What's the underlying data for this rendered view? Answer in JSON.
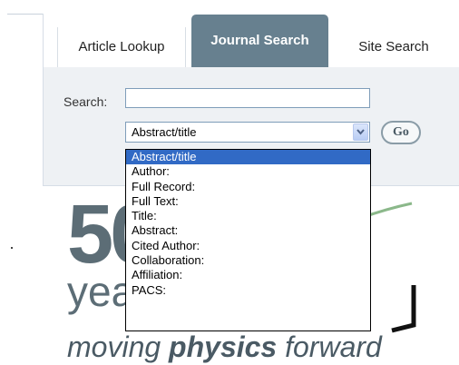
{
  "tabs": [
    {
      "label": "Article Lookup",
      "active": false
    },
    {
      "label": "Journal Search",
      "active": true
    },
    {
      "label": "Site Search",
      "active": false
    }
  ],
  "search": {
    "label": "Search:",
    "value": "",
    "placeholder": ""
  },
  "field_select": {
    "selected": "Abstract/title",
    "options": [
      "Abstract/title",
      "Author:",
      "Full Record:",
      "Full Text:",
      "Title:",
      "Abstract:",
      "Cited Author:",
      "Collaboration:",
      "Affiliation:",
      "PACS:"
    ]
  },
  "go_button": {
    "label": "Go"
  },
  "logo": {
    "number": "50",
    "years": "years",
    "tagline_prefix": "moving ",
    "tagline_bold": "physics",
    "tagline_suffix": " forward"
  },
  "colors": {
    "active_tab": "#67808f",
    "panel_bg": "#eef1f4",
    "selection": "#316ac5",
    "logo_gray": "#5c6d76",
    "logo_green": "#8bb88a"
  }
}
